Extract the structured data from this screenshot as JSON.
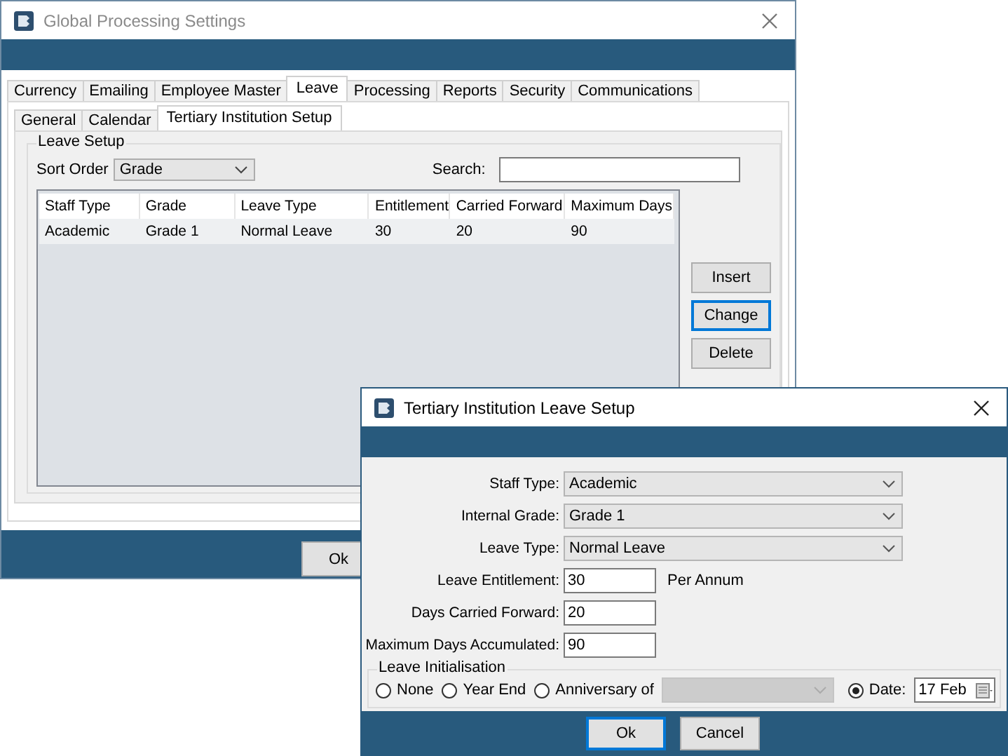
{
  "main_window": {
    "title": "Global Processing Settings",
    "tabs": [
      {
        "label": "Currency",
        "selected": false
      },
      {
        "label": "Emailing",
        "selected": false
      },
      {
        "label": "Employee Master",
        "selected": false
      },
      {
        "label": "Leave",
        "selected": true
      },
      {
        "label": "Processing",
        "selected": false
      },
      {
        "label": "Reports",
        "selected": false
      },
      {
        "label": "Security",
        "selected": false
      },
      {
        "label": "Communications",
        "selected": false
      }
    ],
    "subtabs": [
      {
        "label": "General",
        "selected": false
      },
      {
        "label": "Calendar",
        "selected": false
      },
      {
        "label": "Tertiary Institution Setup",
        "selected": true
      }
    ],
    "group_title": "Leave Setup",
    "sort_order": {
      "label": "Sort Order",
      "value": "Grade"
    },
    "search": {
      "label": "Search:"
    },
    "table": {
      "columns": [
        "Staff Type",
        "Grade",
        "Leave Type",
        "Entitlement",
        "Carried Forward",
        "Maximum Days"
      ],
      "rows": [
        {
          "cells": [
            "Academic",
            "Grade 1",
            "Normal Leave",
            "30",
            "20",
            "90"
          ]
        }
      ]
    },
    "side_buttons": [
      {
        "label": "Insert",
        "focused": false
      },
      {
        "label": "Change",
        "focused": true
      },
      {
        "label": "Delete",
        "focused": false
      }
    ],
    "footer_buttons": [
      {
        "label": "Ok"
      }
    ]
  },
  "dialog": {
    "title": "Tertiary Institution Leave Setup",
    "fields": [
      {
        "label": "Staff Type:",
        "kind": "select",
        "value": "Academic"
      },
      {
        "label": "Internal Grade:",
        "kind": "select",
        "value": "Grade 1"
      },
      {
        "label": "Leave Type:",
        "kind": "select",
        "value": "Normal Leave"
      },
      {
        "label": "Leave Entitlement:",
        "kind": "input",
        "value": "30",
        "suffix": "Per Annum"
      },
      {
        "label": "Days Carried Forward:",
        "kind": "input",
        "value": "20"
      },
      {
        "label": "Maximum Days Accumulated:",
        "kind": "input",
        "value": "90"
      }
    ],
    "initialisation": {
      "title": "Leave Initialisation",
      "options": [
        {
          "label": "None",
          "kind": "plain",
          "selected": false
        },
        {
          "label": "Year End",
          "kind": "plain",
          "selected": false
        },
        {
          "label": "Anniversary of",
          "kind": "with_select",
          "selected": false
        },
        {
          "label": "Date:",
          "kind": "with_date",
          "selected": true,
          "value": "17 Feb"
        }
      ]
    },
    "buttons": [
      {
        "label": "Ok",
        "focused": true
      },
      {
        "label": "Cancel",
        "focused": false
      }
    ]
  }
}
